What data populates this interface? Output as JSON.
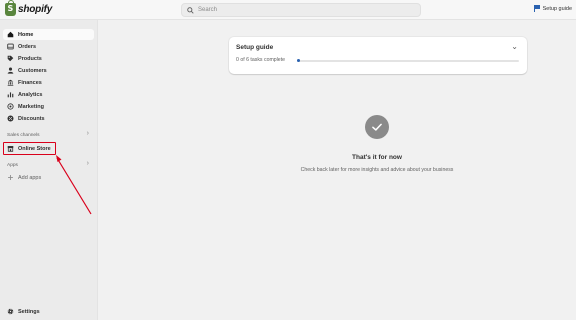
{
  "brand": {
    "name": "shopify"
  },
  "search": {
    "placeholder": "Search"
  },
  "topbar": {
    "setup_guide_label": "Setup guide"
  },
  "sidebar": {
    "items": [
      {
        "label": "Home",
        "icon": "home-icon"
      },
      {
        "label": "Orders",
        "icon": "inbox-icon"
      },
      {
        "label": "Products",
        "icon": "tag-icon"
      },
      {
        "label": "Customers",
        "icon": "person-icon"
      },
      {
        "label": "Finances",
        "icon": "bank-icon"
      },
      {
        "label": "Analytics",
        "icon": "bar-chart-icon"
      },
      {
        "label": "Marketing",
        "icon": "target-icon"
      },
      {
        "label": "Discounts",
        "icon": "discount-icon"
      }
    ],
    "sales_channels_label": "Sales channels",
    "online_store_label": "Online Store",
    "apps_label": "Apps",
    "add_apps_label": "Add apps",
    "settings_label": "Settings"
  },
  "setup_card": {
    "title": "Setup guide",
    "progress_text": "0 of 6 tasks complete",
    "progress_fraction": 0
  },
  "empty_state": {
    "title": "That's it for now",
    "subtitle": "Check back later for more insights and advice about your business"
  },
  "colors": {
    "accent": "#2a62b0",
    "brand_green": "#5a863e",
    "annotation_red": "#d9001b"
  }
}
